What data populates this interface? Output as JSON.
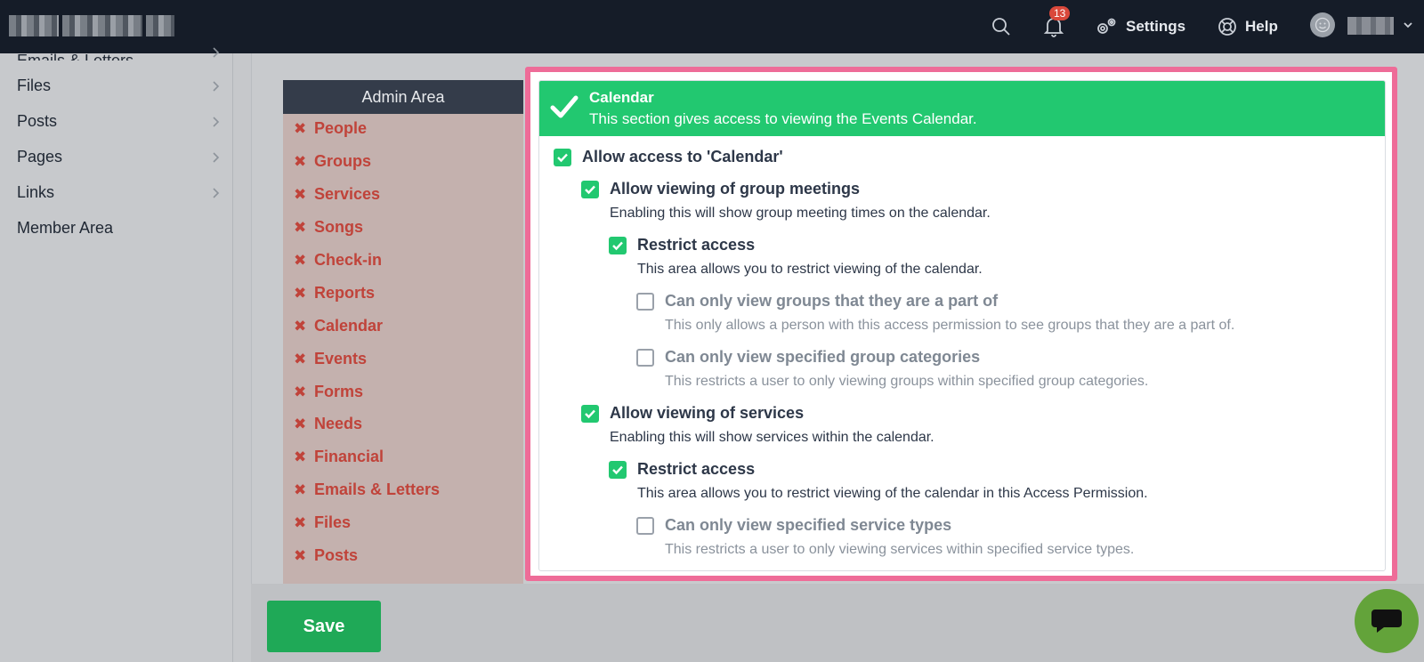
{
  "topbar": {
    "notification_count": "13",
    "settings_label": "Settings",
    "help_label": "Help"
  },
  "sidebar": {
    "items": [
      {
        "label": "Emails & Letters"
      },
      {
        "label": "Files"
      },
      {
        "label": "Posts"
      },
      {
        "label": "Pages"
      },
      {
        "label": "Links"
      },
      {
        "label": "Member Area"
      }
    ]
  },
  "admin_area": {
    "title": "Admin Area",
    "items": [
      {
        "label": "People"
      },
      {
        "label": "Groups"
      },
      {
        "label": "Services"
      },
      {
        "label": "Songs"
      },
      {
        "label": "Check-in"
      },
      {
        "label": "Reports"
      },
      {
        "label": "Calendar"
      },
      {
        "label": "Events"
      },
      {
        "label": "Forms"
      },
      {
        "label": "Needs"
      },
      {
        "label": "Financial"
      },
      {
        "label": "Emails & Letters"
      },
      {
        "label": "Files"
      },
      {
        "label": "Posts"
      }
    ]
  },
  "section": {
    "title": "Calendar",
    "description": "This section gives access to viewing the Events Calendar.",
    "accent_color": "#22c870",
    "permissions": [
      {
        "label": "Allow access to 'Calendar'",
        "checked": true
      },
      {
        "label": "Allow viewing of group meetings",
        "description": "Enabling this will show group meeting times on the calendar.",
        "checked": true
      },
      {
        "label": "Restrict access",
        "description": "This area allows you to restrict viewing of the calendar.",
        "checked": true
      },
      {
        "label": "Can only view groups that they are a part of",
        "description": "This only allows a person with this access permission to see groups that they are a part of.",
        "checked": false
      },
      {
        "label": "Can only view specified group categories",
        "description": "This restricts a user to only viewing groups within specified group categories.",
        "checked": false
      },
      {
        "label": "Allow viewing of services",
        "description": "Enabling this will show services within the calendar.",
        "checked": true
      },
      {
        "label": "Restrict access",
        "description": "This area allows you to restrict viewing of the calendar in this Access Permission.",
        "checked": true
      },
      {
        "label": "Can only view specified service types",
        "description": "This restricts a user to only viewing services within specified service types.",
        "checked": false
      }
    ]
  },
  "footer": {
    "save_label": "Save"
  }
}
